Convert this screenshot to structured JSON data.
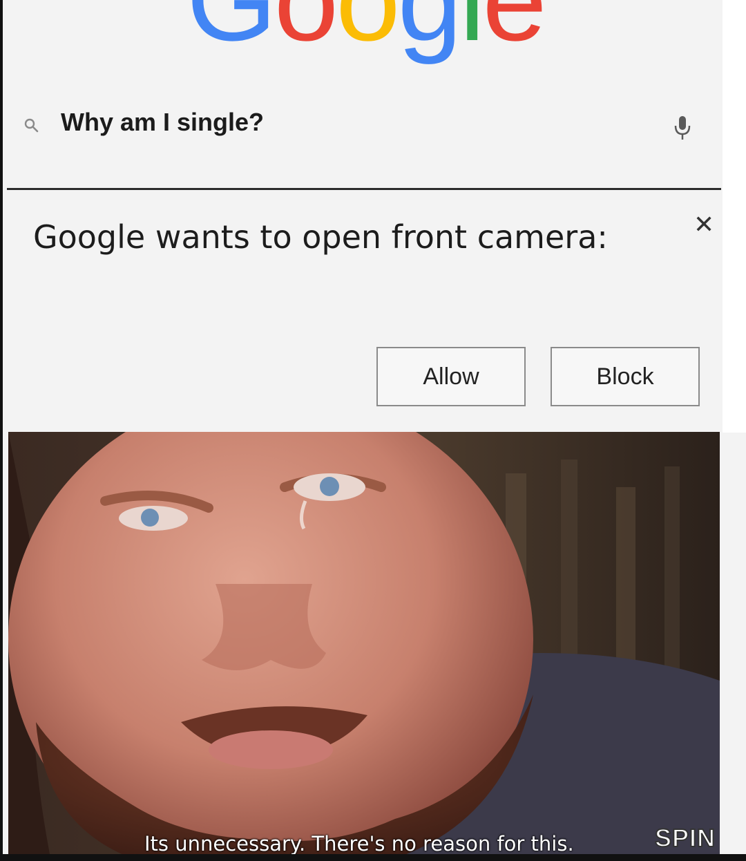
{
  "logo": {
    "letters": [
      {
        "char": "G",
        "color": "#4285F4"
      },
      {
        "char": "o",
        "color": "#EA4335"
      },
      {
        "char": "o",
        "color": "#FBBC05"
      },
      {
        "char": "g",
        "color": "#4285F4"
      },
      {
        "char": "l",
        "color": "#34A853"
      },
      {
        "char": "e",
        "color": "#EA4335"
      }
    ]
  },
  "search": {
    "query": "Why am I single?",
    "search_icon": "search-icon",
    "mic_icon": "microphone-icon"
  },
  "permission_prompt": {
    "message": "Google wants to open front camera:",
    "close_icon": "close-icon",
    "allow_label": "Allow",
    "block_label": "Block"
  },
  "photo": {
    "caption": "Its unnecessary. There's no reason for this.",
    "watermark": "SPIN"
  }
}
